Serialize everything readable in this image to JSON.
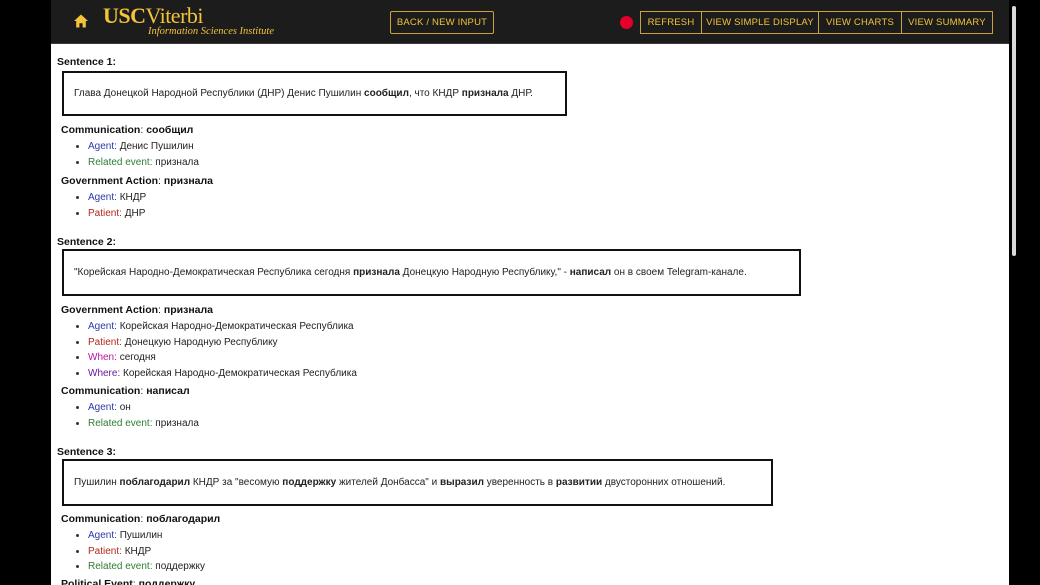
{
  "navbar": {
    "logo_usc": "USC",
    "logo_viterbi": "Viterbi",
    "logo_sub": "Information Sciences Institute",
    "buttons": {
      "back": "Back / New Input",
      "refresh": "Refresh",
      "simple": "View Simple Display",
      "charts": "View Charts",
      "summary": "View Summary"
    },
    "colors": {
      "accent": "#f2c33b",
      "record": "#e4002b",
      "bar": "#1c1c1c"
    }
  },
  "sentences": [
    {
      "label": "Sentence 1:",
      "parts": [
        {
          "t": "Глава Донецкой Народной Республики (ДНР) Денис Пушилин ",
          "b": false
        },
        {
          "t": "сообщил",
          "b": true
        },
        {
          "t": ", что КНДР ",
          "b": false
        },
        {
          "t": "признала",
          "b": true
        },
        {
          "t": " ДНР.",
          "b": false
        }
      ],
      "events": [
        {
          "type": "Communication",
          "trigger": "сообщил",
          "args": [
            {
              "role": "Agent",
              "cls": "agent",
              "value": "Денис Пушилин"
            },
            {
              "role": "Related event",
              "cls": "related",
              "value": "признала"
            }
          ]
        },
        {
          "type": "Government Action",
          "trigger": "признала",
          "args": [
            {
              "role": "Agent",
              "cls": "agent",
              "value": "КНДР"
            },
            {
              "role": "Patient",
              "cls": "patient",
              "value": "ДНР"
            }
          ]
        }
      ]
    },
    {
      "label": "Sentence 2:",
      "parts": [
        {
          "t": "\"Корейская Народно-Демократическая Республика сегодня ",
          "b": false
        },
        {
          "t": "признала",
          "b": true
        },
        {
          "t": " Донецкую Народную Республику,\" - ",
          "b": false
        },
        {
          "t": "написал",
          "b": true
        },
        {
          "t": " он в своем Telegram-канале.",
          "b": false
        }
      ],
      "events": [
        {
          "type": "Government Action",
          "trigger": "признала",
          "args": [
            {
              "role": "Agent",
              "cls": "agent",
              "value": "Корейская Народно-Демократическая Республика"
            },
            {
              "role": "Patient",
              "cls": "patient",
              "value": "Донецкую Народную Республику"
            },
            {
              "role": "When",
              "cls": "when",
              "value": "сегодня"
            },
            {
              "role": "Where",
              "cls": "where",
              "value": "Корейская Народно-Демократическая Республика"
            }
          ]
        },
        {
          "type": "Communication",
          "trigger": "написал",
          "args": [
            {
              "role": "Agent",
              "cls": "agent",
              "value": "он"
            },
            {
              "role": "Related event",
              "cls": "related",
              "value": "признала"
            }
          ]
        }
      ]
    },
    {
      "label": "Sentence 3:",
      "parts": [
        {
          "t": "Пушилин ",
          "b": false
        },
        {
          "t": "поблагодарил",
          "b": true
        },
        {
          "t": " КНДР за \"весомую ",
          "b": false
        },
        {
          "t": "поддержку",
          "b": true
        },
        {
          "t": " жителей Донбасса\" и ",
          "b": false
        },
        {
          "t": "выразил",
          "b": true
        },
        {
          "t": " уверенность в ",
          "b": false
        },
        {
          "t": "развитии",
          "b": true
        },
        {
          "t": " двусторонних отношений.",
          "b": false
        }
      ],
      "events": [
        {
          "type": "Communication",
          "trigger": "поблагодарил",
          "args": [
            {
              "role": "Agent",
              "cls": "agent",
              "value": "Пушилин"
            },
            {
              "role": "Patient",
              "cls": "patient",
              "value": "КНДР"
            },
            {
              "role": "Related event",
              "cls": "related",
              "value": "поддержку"
            }
          ]
        },
        {
          "type": "Political Event",
          "trigger": "поддержку",
          "args": []
        }
      ]
    }
  ]
}
